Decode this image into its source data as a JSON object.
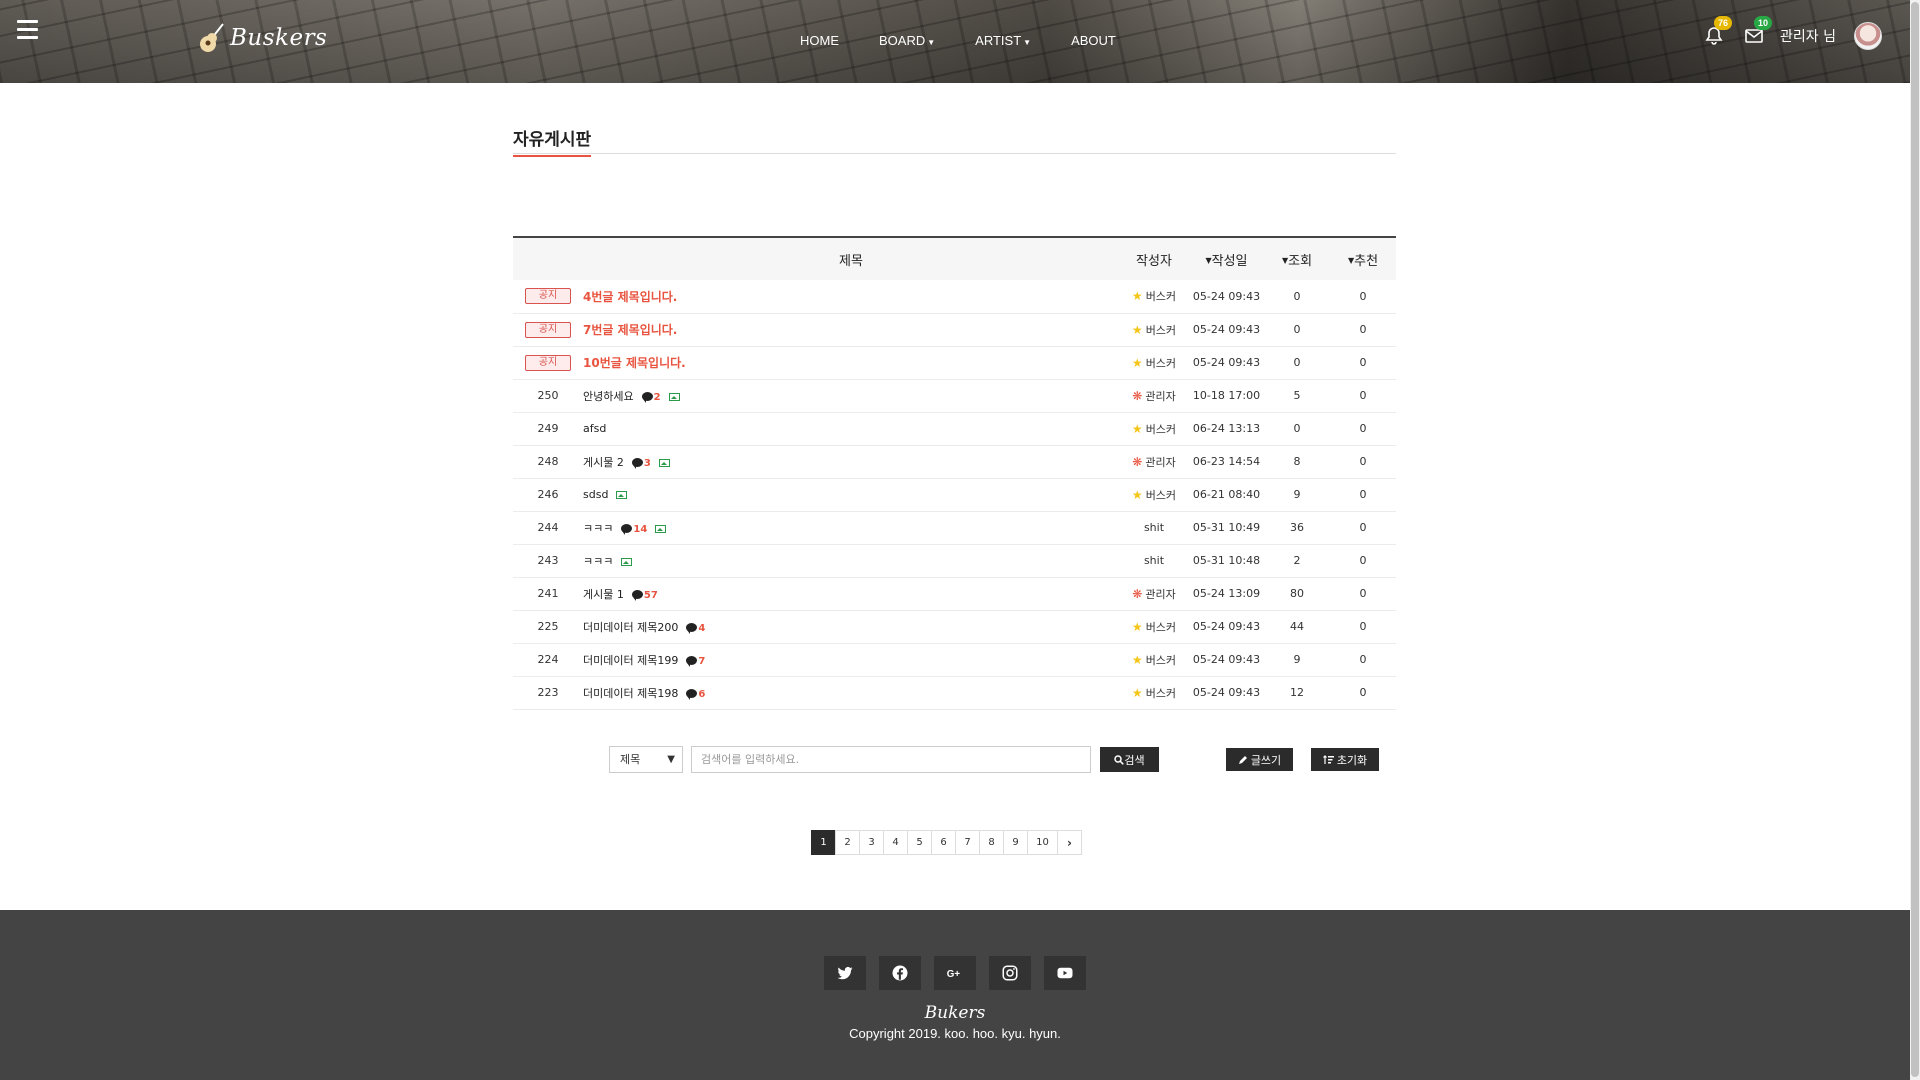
{
  "header": {
    "brand": "Buskers",
    "nav": [
      {
        "label": "HOME",
        "dropdown": false
      },
      {
        "label": "BOARD",
        "dropdown": true
      },
      {
        "label": "ARTIST",
        "dropdown": true
      },
      {
        "label": "ABOUT",
        "dropdown": false
      }
    ],
    "notifications_count": "76",
    "messages_count": "10",
    "user_name": "관리자 님"
  },
  "board": {
    "title": "자유게시판",
    "columns": {
      "title": "제목",
      "author": "작성자",
      "date": "작성일",
      "views": "조회",
      "likes": "추천"
    },
    "notice_label": "공지",
    "notices": [
      {
        "title": "4번글 제목입니다.",
        "author": "버스커",
        "date": "05-24 09:43",
        "views": "0",
        "likes": "0"
      },
      {
        "title": "7번글 제목입니다.",
        "author": "버스커",
        "date": "05-24 09:43",
        "views": "0",
        "likes": "0"
      },
      {
        "title": "10번글 제목입니다.",
        "author": "버스커",
        "date": "05-24 09:43",
        "views": "0",
        "likes": "0"
      }
    ],
    "posts": [
      {
        "no": "250",
        "title": "안녕하세요",
        "comments": "2",
        "image": true,
        "author": "관리자",
        "role": "admin",
        "date": "10-18 17:00",
        "views": "5",
        "likes": "0"
      },
      {
        "no": "249",
        "title": "afsd",
        "comments": "",
        "image": false,
        "author": "버스커",
        "role": "busker",
        "date": "06-24 13:13",
        "views": "0",
        "likes": "0"
      },
      {
        "no": "248",
        "title": "게시물 2",
        "comments": "3",
        "image": true,
        "author": "관리자",
        "role": "admin",
        "date": "06-23 14:54",
        "views": "8",
        "likes": "0"
      },
      {
        "no": "246",
        "title": "sdsd",
        "comments": "",
        "image": true,
        "author": "버스커",
        "role": "busker",
        "date": "06-21 08:40",
        "views": "9",
        "likes": "0"
      },
      {
        "no": "244",
        "title": "ㅋㅋㅋ",
        "comments": "14",
        "image": true,
        "author": "shit",
        "role": "none",
        "date": "05-31 10:49",
        "views": "36",
        "likes": "0"
      },
      {
        "no": "243",
        "title": "ㅋㅋㅋ",
        "comments": "",
        "image": true,
        "author": "shit",
        "role": "none",
        "date": "05-31 10:48",
        "views": "2",
        "likes": "0"
      },
      {
        "no": "241",
        "title": "게시물 1",
        "comments": "57",
        "image": false,
        "author": "관리자",
        "role": "admin",
        "date": "05-24 13:09",
        "views": "80",
        "likes": "0"
      },
      {
        "no": "225",
        "title": "더미데이터 제목200",
        "comments": "4",
        "image": false,
        "author": "버스커",
        "role": "busker",
        "date": "05-24 09:43",
        "views": "44",
        "likes": "0"
      },
      {
        "no": "224",
        "title": "더미데이터 제목199",
        "comments": "7",
        "image": false,
        "author": "버스커",
        "role": "busker",
        "date": "05-24 09:43",
        "views": "9",
        "likes": "0"
      },
      {
        "no": "223",
        "title": "더미데이터 제목198",
        "comments": "6",
        "image": false,
        "author": "버스커",
        "role": "busker",
        "date": "05-24 09:43",
        "views": "12",
        "likes": "0"
      }
    ]
  },
  "search": {
    "select_value": "제목",
    "placeholder": "검색어를 입력하세요.",
    "search_label": "검색",
    "write_label": "글쓰기",
    "reset_label": "초기화"
  },
  "pagination": {
    "pages": [
      "1",
      "2",
      "3",
      "4",
      "5",
      "6",
      "7",
      "8",
      "9",
      "10"
    ],
    "current": "1",
    "next": "›"
  },
  "footer": {
    "socials": [
      "twitter-icon",
      "facebook-icon",
      "google-plus-icon",
      "instagram-icon",
      "youtube-icon"
    ],
    "brand": "Bukers",
    "copyright": "Copyright 2019. koo. hoo. kyu. hyun."
  },
  "colors": {
    "accent": "#e8543f",
    "dark_button": "#2b2b2b",
    "footer_bg": "#444444",
    "badge_yellow": "#e6b800",
    "badge_green": "#28a745"
  }
}
